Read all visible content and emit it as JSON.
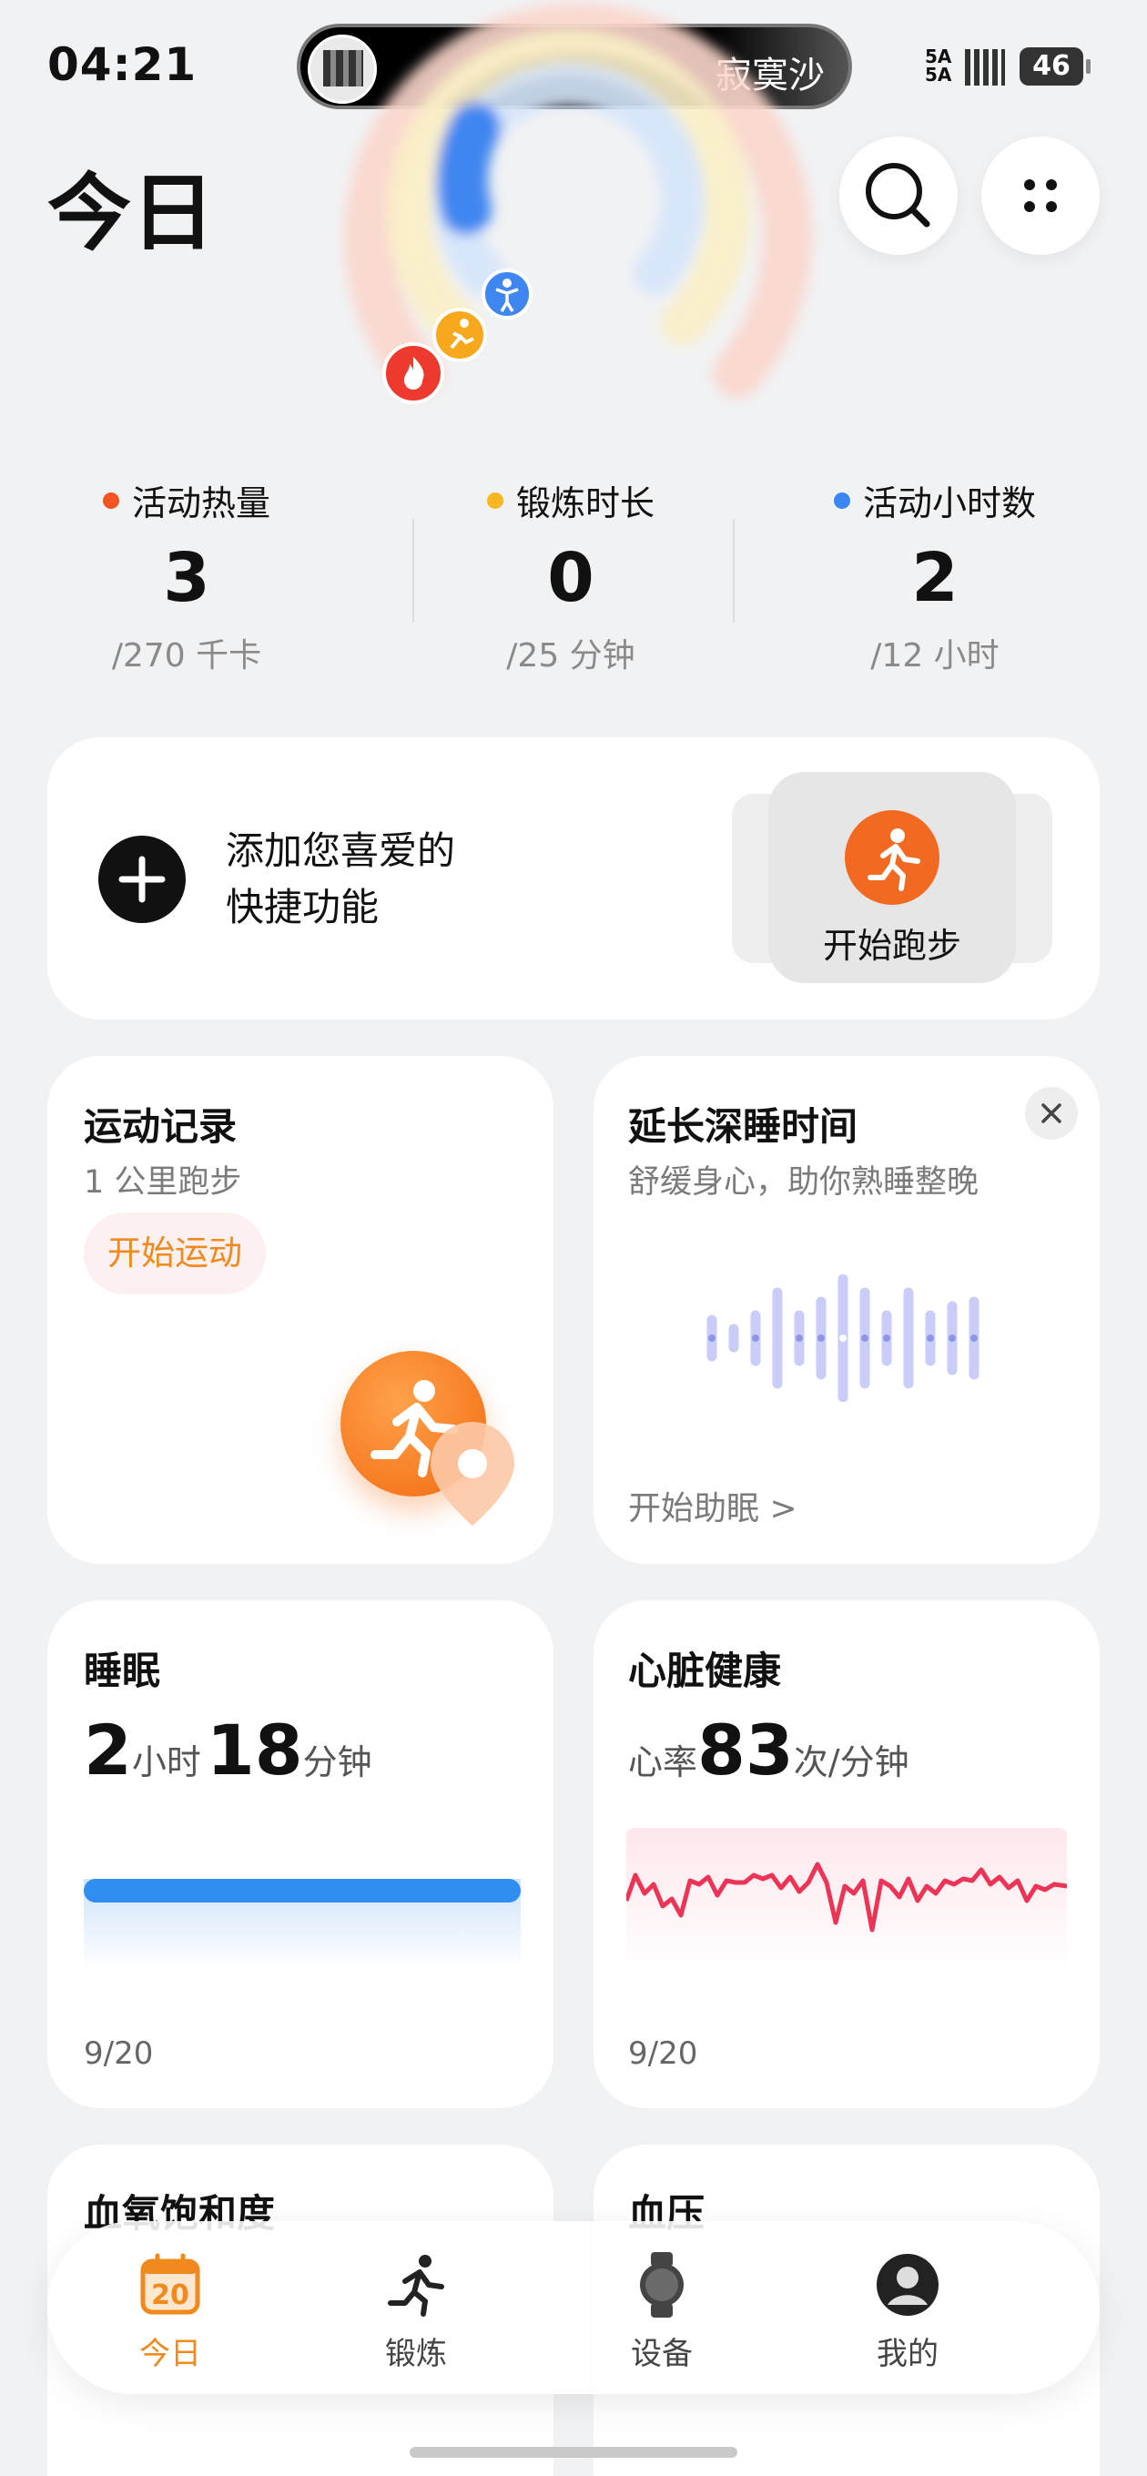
{
  "status_bar": {
    "time": "04:21",
    "island_text": "寂寞沙",
    "network": "5A",
    "battery": "46"
  },
  "header": {
    "title": "今日"
  },
  "activity": {
    "calories": {
      "label": "活动热量",
      "value": "3",
      "target": "/270 千卡",
      "color": "#f25524"
    },
    "exercise": {
      "label": "锻炼时长",
      "value": "0",
      "target": "/25 分钟",
      "color": "#f7b723"
    },
    "stand": {
      "label": "活动小时数",
      "value": "2",
      "target": "/12 小时",
      "color": "#3a86f2"
    }
  },
  "shortcut_card": {
    "text_line1": "添加您喜爱的",
    "text_line2": "快捷功能",
    "quick_action_label": "开始跑步"
  },
  "exercise_card": {
    "title": "运动记录",
    "subtitle": "1 公里跑步",
    "button": "开始运动"
  },
  "sleep_aid_card": {
    "title": "延长深睡时间",
    "subtitle": "舒缓身心，助你熟睡整晚",
    "link": "开始助眠 >"
  },
  "sleep_card": {
    "title": "睡眠",
    "hours": "2",
    "hours_unit": "小时",
    "minutes": "18",
    "minutes_unit": "分钟",
    "date": "9/20"
  },
  "heart_card": {
    "title": "心脏健康",
    "prefix": "心率",
    "value": "83",
    "unit": "次/分钟",
    "date": "9/20"
  },
  "spo2_card": {
    "title": "血氧饱和度"
  },
  "bp_card": {
    "title": "血压"
  },
  "tabs": [
    {
      "label": "今日",
      "icon": "calendar-icon",
      "date": "20",
      "active": true
    },
    {
      "label": "锻炼",
      "icon": "running-icon",
      "active": false
    },
    {
      "label": "设备",
      "icon": "watch-icon",
      "active": false
    },
    {
      "label": "我的",
      "icon": "profile-icon",
      "active": false
    }
  ]
}
